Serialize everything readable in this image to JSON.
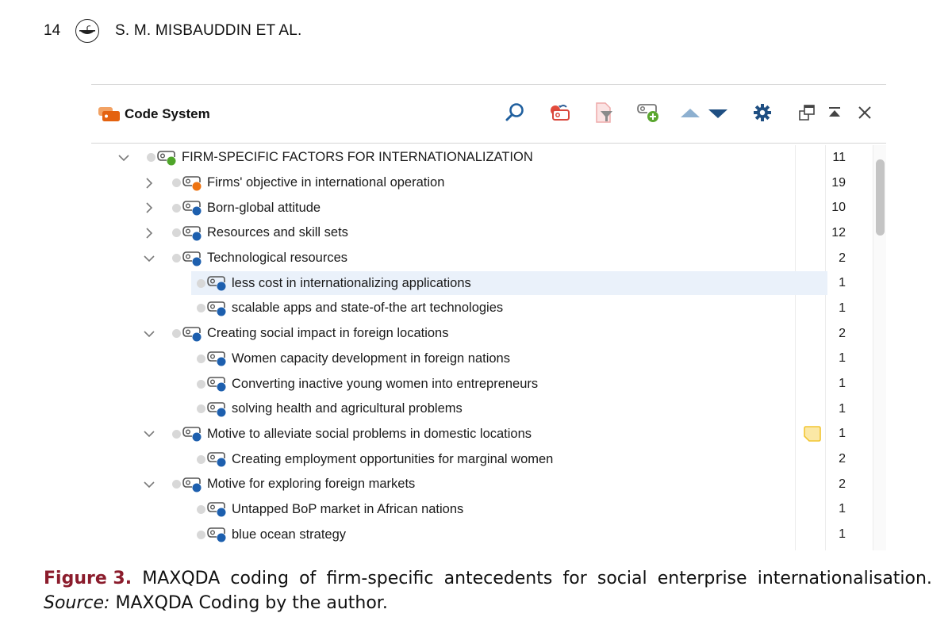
{
  "running_head": {
    "page_number": "14",
    "logo_icon": "journal-lamp-logo-icon",
    "authors": "S. M. MISBAUDDIN ET AL."
  },
  "panel": {
    "title": "Code System",
    "title_icon": "code-system-icon",
    "toolbar": [
      {
        "name": "search",
        "icon": "search-icon",
        "color": "#1f5f9e"
      },
      {
        "name": "reset-activations",
        "icon": "reset-codes-icon",
        "color": "#d9463b"
      },
      {
        "name": "filter",
        "icon": "filter-document-icon",
        "color": "#e8a0a0"
      },
      {
        "name": "new-code",
        "icon": "new-code-icon",
        "color": "#5aa62f"
      },
      {
        "name": "move-up",
        "icon": "triangle-up-icon",
        "color": "#8db0d0"
      },
      {
        "name": "move-down",
        "icon": "triangle-down-icon",
        "color": "#1f4f82"
      },
      {
        "name": "settings",
        "icon": "gear-icon",
        "color": "#1f4f82"
      },
      {
        "name": "undock",
        "icon": "undock-window-icon",
        "color": "#333333"
      },
      {
        "name": "collapse",
        "icon": "collapse-top-icon",
        "color": "#333333"
      },
      {
        "name": "close",
        "icon": "close-icon",
        "color": "#333333"
      }
    ]
  },
  "colors": {
    "green": "#4fa52a",
    "orange": "#ee7311",
    "blue": "#1d5fae",
    "selected_row": "#eaf1fa",
    "memo_fill": "#fbe8a6",
    "memo_border": "#f2c531",
    "caption_label": "#8b1c2c"
  },
  "tree": [
    {
      "label": "FIRM-SPECIFIC FACTORS FOR INTERNATIONALIZATION",
      "count": "11",
      "level": 0,
      "expander": "expanded",
      "color": "green"
    },
    {
      "label": "Firms' objective in international operation",
      "count": "19",
      "level": 1,
      "expander": "collapsed",
      "color": "orange"
    },
    {
      "label": "Born-global attitude",
      "count": "10",
      "level": 1,
      "expander": "collapsed",
      "color": "blue"
    },
    {
      "label": "Resources and skill sets",
      "count": "12",
      "level": 1,
      "expander": "collapsed",
      "color": "blue"
    },
    {
      "label": "Technological resources",
      "count": "2",
      "level": 1,
      "expander": "expanded",
      "color": "blue"
    },
    {
      "label": "less cost in internationalizing applications",
      "count": "1",
      "level": 2,
      "expander": "none",
      "color": "blue",
      "selected": true
    },
    {
      "label": "scalable apps and state-of-the art technologies",
      "count": "1",
      "level": 2,
      "expander": "none",
      "color": "blue"
    },
    {
      "label": "Creating social impact in foreign locations",
      "count": "2",
      "level": 1,
      "expander": "expanded",
      "color": "blue"
    },
    {
      "label": "Women capacity development in foreign nations",
      "count": "1",
      "level": 2,
      "expander": "none",
      "color": "blue"
    },
    {
      "label": "Converting inactive young women into entrepreneurs",
      "count": "1",
      "level": 2,
      "expander": "none",
      "color": "blue"
    },
    {
      "label": "solving health and agricultural problems",
      "count": "1",
      "level": 2,
      "expander": "none",
      "color": "blue"
    },
    {
      "label": "Motive to alleviate social problems in domestic locations",
      "count": "1",
      "level": 1,
      "expander": "expanded",
      "color": "blue",
      "memo": true
    },
    {
      "label": "Creating employment opportunities for marginal women",
      "count": "2",
      "level": 2,
      "expander": "none",
      "color": "blue"
    },
    {
      "label": "Motive for exploring foreign markets",
      "count": "2",
      "level": 1,
      "expander": "expanded",
      "color": "blue"
    },
    {
      "label": "Untapped BoP market in African nations",
      "count": "1",
      "level": 2,
      "expander": "none",
      "color": "blue"
    },
    {
      "label": "blue ocean strategy",
      "count": "1",
      "level": 2,
      "expander": "none",
      "color": "blue"
    }
  ],
  "caption": {
    "label": "Figure 3.",
    "words": [
      "MAXQDA",
      "coding",
      "of",
      "firm-specific",
      "antecedents",
      "for",
      "social",
      "enterprise",
      "internationalisation."
    ],
    "source_label": "Source:",
    "source_text": " MAXQDA Coding by the author."
  }
}
